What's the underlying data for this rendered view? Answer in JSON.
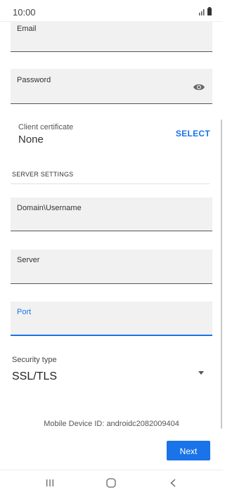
{
  "status_bar": {
    "time": "10:00"
  },
  "form": {
    "email": {
      "label": "Email",
      "value": ""
    },
    "password": {
      "label": "Password",
      "value": ""
    },
    "client_certificate": {
      "label": "Client certificate",
      "value": "None",
      "action_label": "SELECT"
    },
    "server_settings": {
      "header": "SERVER SETTINGS",
      "domain_username": {
        "label": "Domain\\Username",
        "value": ""
      },
      "server": {
        "label": "Server",
        "value": ""
      },
      "port": {
        "label": "Port",
        "value": "",
        "focused": true
      }
    },
    "security_type": {
      "label": "Security type",
      "value": "SSL/TLS"
    }
  },
  "footer": {
    "device_id_text": "Mobile Device ID: androidc2082009404",
    "next_label": "Next"
  },
  "icons": {
    "signal": "signal-icon",
    "battery": "battery-icon",
    "password_visibility": "eye-icon",
    "dropdown": "dropdown-arrow-icon",
    "recents": "recents-icon",
    "home": "home-icon",
    "back": "back-icon"
  },
  "colors": {
    "accent": "#1a73e8",
    "field_background": "#f1f1f1"
  }
}
